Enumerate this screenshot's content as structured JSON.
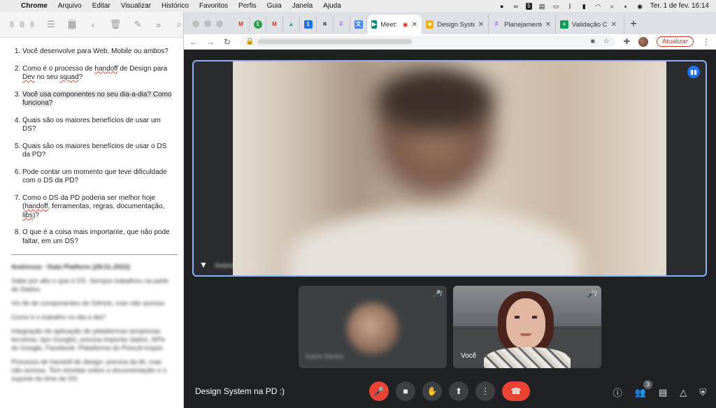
{
  "menubar": {
    "app": "Chrome",
    "items": [
      "Arquivo",
      "Editar",
      "Visualizar",
      "Histórico",
      "Favoritos",
      "Perfis",
      "Guia",
      "Janela",
      "Ajuda"
    ],
    "tray_badge": "5",
    "datetime": "Ter. 1 de fev.  16:14"
  },
  "notes": {
    "questions": [
      {
        "pre": "Você desenvolve para Web, Mobile ou ambos?",
        "post": ""
      },
      {
        "pre": "Como é o processo de ",
        "mark": "handoff",
        "post": " de Design para ",
        "mark2": "Dev",
        "post2": " no seu ",
        "mark3": "squad",
        "post3": "?"
      },
      {
        "pre": "Você usa componentes no seu dia-a-dia? Como funciona?"
      },
      {
        "pre": "Quais são os maiores benefícios de usar um DS?"
      },
      {
        "pre": "Quais são os maiores benefícios de usar o DS da PD?"
      },
      {
        "pre": "Pode contar um momento que teve dificuldade com o DS da PD?"
      },
      {
        "pre": "Como o DS da PD poderia ser melhor hoje (",
        "mark": "handoff",
        "post": ", ferramentas, regras, documentação, ",
        "mark2": "libs",
        "post2": ")?"
      },
      {
        "pre": "O que é a coisa mais importante, que não pode faltar, em um DS?"
      }
    ],
    "blurred_heading": "Andressa - Data Platform (28.01.2022)",
    "blurred_lines": [
      "Sabe por alto o que é DS. Sempre trabalhou na parte de Dados.",
      "Viu lib de componentes do GitHub, mas não acessa.",
      "Como é o trabalho no dia a dia?",
      "Integração de aplicação de plataformas (empresas terceiras, tipo Google), precisa importar dados, APIs do Google, Facebook. Plataforma do Presult-Insper.",
      "Processo de handoff de design: precisa da lib, mas não acessa. Tem dúvidas sobre a documentação e o suporte do time de DS."
    ]
  },
  "chrome": {
    "pinned": [
      {
        "name": "gmail",
        "glyph": "M",
        "color": "#d93025"
      },
      {
        "name": "whatsapp",
        "glyph": "1",
        "color": "#25a244"
      },
      {
        "name": "gmail-2",
        "glyph": "M",
        "color": "#d93025"
      },
      {
        "name": "drive",
        "glyph": "▲",
        "color": "#1fa463"
      },
      {
        "name": "calendar",
        "glyph": "1",
        "color": "#1a73e8"
      },
      {
        "name": "x-app",
        "glyph": "✕",
        "color": "#222222"
      },
      {
        "name": "figma",
        "glyph": "F",
        "color": "#a259ff"
      },
      {
        "name": "translate",
        "glyph": "文",
        "color": "#4285f4"
      }
    ],
    "tabs": [
      {
        "title": "Meet: De",
        "color": "#00897b",
        "glyph": "▶",
        "active": true,
        "recording": true
      },
      {
        "title": "Design Syste",
        "color": "#f4b400",
        "glyph": "■",
        "active": false
      },
      {
        "title": "Planejamento",
        "color": "#a259ff",
        "glyph": "F",
        "active": false
      },
      {
        "title": "Validação C",
        "color": "#0f9d58",
        "glyph": "+",
        "active": false
      }
    ],
    "update_label": "Atualizar"
  },
  "meet": {
    "meeting_title": "Design System na PD :)",
    "main_name": "Andressa Silva",
    "tile1_name": "Inacio Santos",
    "tile2_name": "Você",
    "participants_count": "3"
  }
}
